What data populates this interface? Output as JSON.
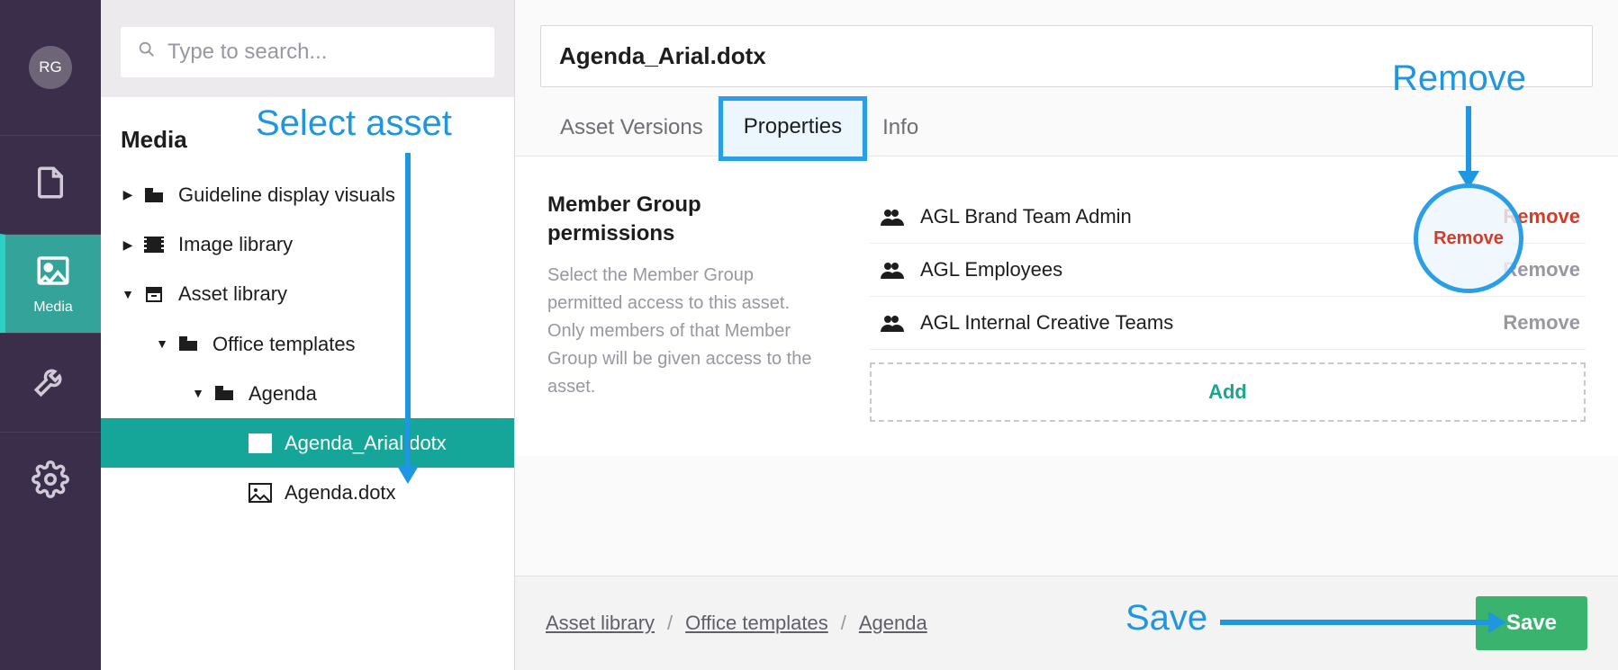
{
  "avatar_initials": "RG",
  "search": {
    "placeholder": "Type to search..."
  },
  "nav": {
    "media_label": "Media"
  },
  "tree": {
    "heading": "Media",
    "items": [
      {
        "label": "Guideline display visuals"
      },
      {
        "label": "Image library"
      },
      {
        "label": "Asset library"
      },
      {
        "label": "Office templates"
      },
      {
        "label": "Agenda"
      },
      {
        "label": "Agenda_Arial.dotx"
      },
      {
        "label": "Agenda.dotx"
      }
    ]
  },
  "asset": {
    "title": "Agenda_Arial.dotx"
  },
  "tabs": {
    "versions": "Asset Versions",
    "properties": "Properties",
    "info": "Info"
  },
  "permissions": {
    "title": "Member Group permissions",
    "desc": "Select the Member Group permitted access to this asset. Only members of that Member Group will be given access to the asset.",
    "groups": [
      {
        "name": "AGL Brand Team Admin",
        "remove": "Remove"
      },
      {
        "name": "AGL Employees",
        "remove": "Remove"
      },
      {
        "name": "AGL Internal Creative Teams",
        "remove": "Remove"
      }
    ],
    "add_label": "Add"
  },
  "breadcrumbs": [
    "Asset library",
    "Office templates",
    "Agenda"
  ],
  "save_label": "Save",
  "annotations": {
    "select_asset": "Select asset",
    "remove": "Remove",
    "save": "Save"
  }
}
